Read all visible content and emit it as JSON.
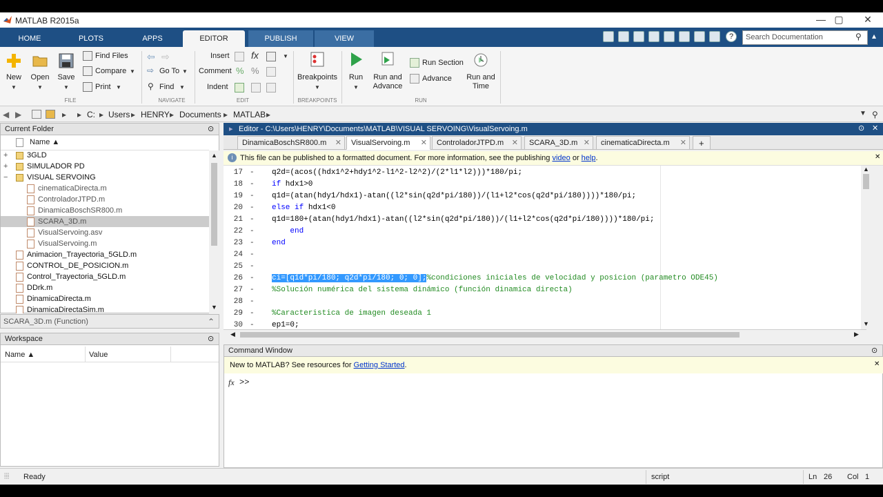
{
  "window": {
    "title": "MATLAB R2015a",
    "minimize": "—",
    "maximize": "▢",
    "close": "✕"
  },
  "ribbon_tabs": [
    "HOME",
    "PLOTS",
    "APPS",
    "EDITOR",
    "PUBLISH",
    "VIEW"
  ],
  "search": {
    "placeholder": "Search Documentation"
  },
  "ribbon": {
    "new": "New",
    "open": "Open",
    "save": "Save",
    "find_files": "Find Files",
    "compare": "Compare",
    "print": "Print",
    "go_to": "Go To",
    "find": "Find",
    "insert": "Insert",
    "comment": "Comment",
    "indent": "Indent",
    "breakpoints": "Breakpoints",
    "run": "Run",
    "run_and_advance": "Run and\nAdvance",
    "run_section": "Run Section",
    "advance": "Advance",
    "run_and_time": "Run and\nTime",
    "sections": {
      "file": "FILE",
      "navigate": "NAVIGATE",
      "edit": "EDIT",
      "breakpoints": "BREAKPOINTS",
      "run": "RUN"
    }
  },
  "address": [
    "C:",
    "Users",
    "HENRY",
    "Documents",
    "MATLAB"
  ],
  "current_folder": {
    "title": "Current Folder",
    "col_name": "Name ▲",
    "items": [
      {
        "name": "3GLD",
        "type": "folder",
        "indent": 0,
        "expand": "+"
      },
      {
        "name": "SIMULADOR PD",
        "type": "folder",
        "indent": 0,
        "expand": "+"
      },
      {
        "name": "VISUAL SERVOING",
        "type": "folder",
        "indent": 0,
        "expand": "−"
      },
      {
        "name": "cinematicaDirecta.m",
        "type": "file",
        "indent": 1,
        "expand": ""
      },
      {
        "name": "ControladorJTPD.m",
        "type": "file",
        "indent": 1,
        "expand": ""
      },
      {
        "name": "DinamicaBoschSR800.m",
        "type": "file",
        "indent": 1,
        "expand": ""
      },
      {
        "name": "SCARA_3D.m",
        "type": "file",
        "indent": 1,
        "expand": ""
      },
      {
        "name": "VisualServoing.asv",
        "type": "file",
        "indent": 1,
        "expand": ""
      },
      {
        "name": "VisualServoing.m",
        "type": "file",
        "indent": 1,
        "expand": ""
      },
      {
        "name": "Animacion_Trayectoria_5GLD.m",
        "type": "file",
        "indent": 0,
        "expand": ""
      },
      {
        "name": "CONTROL_DE_POSICION.m",
        "type": "file",
        "indent": 0,
        "expand": ""
      },
      {
        "name": "Control_Trayectoria_5GLD.m",
        "type": "file",
        "indent": 0,
        "expand": ""
      },
      {
        "name": "DDrk.m",
        "type": "file",
        "indent": 0,
        "expand": ""
      },
      {
        "name": "DinamicaDirecta.m",
        "type": "file",
        "indent": 0,
        "expand": ""
      },
      {
        "name": "DinamicaDirectaSim.m",
        "type": "file",
        "indent": 0,
        "expand": ""
      }
    ],
    "selected_index": 6,
    "detail": "SCARA_3D.m (Function)"
  },
  "workspace": {
    "title": "Workspace",
    "col_name": "Name ▲",
    "col_value": "Value"
  },
  "editor": {
    "title": "Editor - C:\\Users\\HENRY\\Documents\\MATLAB\\VISUAL SERVOING\\VisualServoing.m",
    "tabs": [
      "DinamicaBoschSR800.m",
      "VisualServoing.m",
      "ControladorJTPD.m",
      "SCARA_3D.m",
      "cinematicaDirecta.m"
    ],
    "active_tab": 1,
    "add_tab": "+",
    "publish_note_pre": "This file can be published to a formatted document. For more information, see the publishing ",
    "publish_video": "video",
    "publish_or": " or ",
    "publish_help": "help",
    "publish_dot": ".",
    "lines": [
      {
        "n": "17",
        "code": "q2d=(acos((hdx1^2+hdy1^2-l1^2-l2^2)/(2*l1*l2)))*180/pi;"
      },
      {
        "n": "18",
        "code": "if hdx1>0"
      },
      {
        "n": "19",
        "code": "q1d=(atan(hdy1/hdx1)-atan((l2*sin(q2d*pi/180))/(l1+l2*cos(q2d*pi/180))))*180/pi;"
      },
      {
        "n": "20",
        "code": "else if hdx1<0"
      },
      {
        "n": "21",
        "code": "q1d=180+(atan(hdy1/hdx1)-atan((l2*sin(q2d*pi/180))/(l1+l2*cos(q2d*pi/180))))*180/pi;"
      },
      {
        "n": "22",
        "code": "    end"
      },
      {
        "n": "23",
        "code": "end"
      },
      {
        "n": "24",
        "code": ""
      },
      {
        "n": "25",
        "code": ""
      },
      {
        "n": "26",
        "code": "ci=[q1d*pi/180; q2d*pi/180; 0; 0];",
        "comment": "%condiciones iniciales de velocidad y posicion (parametro ODE45)"
      },
      {
        "n": "27",
        "code": "",
        "comment": "%Solución numérica del sistema dinámico (función dinamica directa)"
      },
      {
        "n": "28",
        "code": ""
      },
      {
        "n": "29",
        "code": "",
        "comment": "%Caracteristica de imagen deseada 1"
      },
      {
        "n": "30",
        "code": "ep1=0;"
      }
    ]
  },
  "command_window": {
    "title": "Command Window",
    "note_pre": "New to MATLAB? See resources for ",
    "note_link": "Getting Started",
    "note_dot": ".",
    "fx": "fx",
    "prompt": ">>"
  },
  "status": {
    "ready": "Ready",
    "mode": "script",
    "ln_label": "Ln",
    "ln": "26",
    "col_label": "Col",
    "col": "1"
  }
}
